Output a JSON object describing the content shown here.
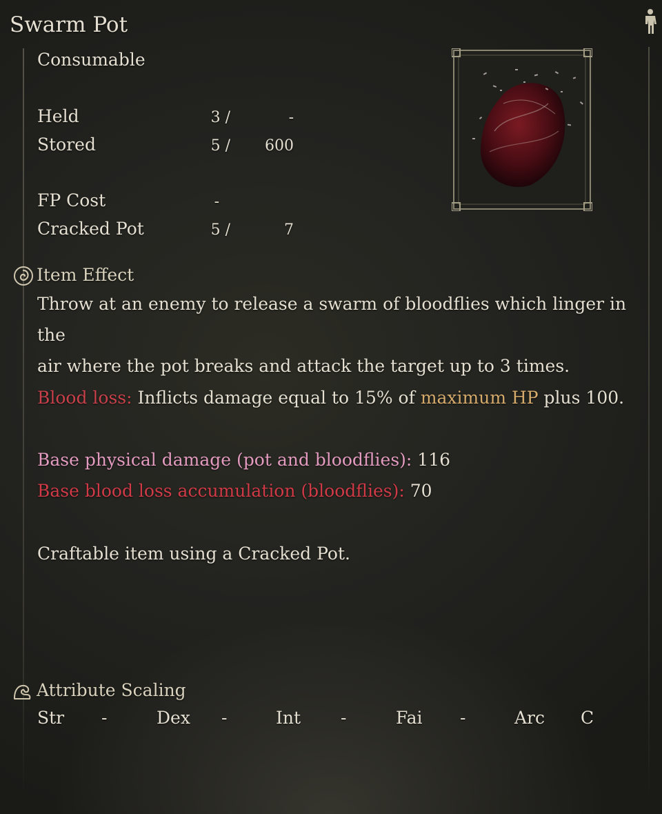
{
  "item": {
    "title": "Swarm Pot",
    "category": "Consumable"
  },
  "stats": {
    "held": {
      "label": "Held",
      "current": "3 /",
      "max": "-"
    },
    "stored": {
      "label": "Stored",
      "current": "5 /",
      "max": "600"
    },
    "fp_cost": {
      "label": "FP Cost",
      "value": "-"
    },
    "cracked_pot": {
      "label": "Cracked Pot",
      "current": "5 /",
      "max": "7"
    }
  },
  "item_effect": {
    "heading": "Item Effect",
    "desc_line1": "Throw at an enemy to release a swarm of bloodflies which linger in the",
    "desc_line2": "air where the pot breaks and attack the target up to 3 times.",
    "blood_loss_label": "Blood loss:",
    "blood_loss_text1": " Inflicts damage equal to 15% of ",
    "blood_loss_highlight": "maximum HP",
    "blood_loss_text2": " plus 100.",
    "phys_label": "Base physical damage (pot and bloodflies):",
    "phys_value": " 116",
    "bloodacc_label": "Base blood loss accumulation (bloodflies):",
    "bloodacc_value": " 70",
    "craft_note": "Craftable item using a Cracked Pot."
  },
  "attribute_scaling": {
    "heading": "Attribute Scaling",
    "items": [
      {
        "label": "Str",
        "value": "-"
      },
      {
        "label": "Dex",
        "value": "-"
      },
      {
        "label": "Int",
        "value": "-"
      },
      {
        "label": "Fai",
        "value": "-"
      },
      {
        "label": "Arc",
        "value": "C"
      }
    ]
  },
  "icons": {
    "equipment_figure": "figure-icon",
    "item_effect": "swirl-icon",
    "attribute_scaling": "arm-icon"
  },
  "colors": {
    "blood_loss": "#c8404a",
    "highlight": "#d6ab6c",
    "physical": "#e39bbf",
    "blood_accum": "#cf3a46"
  }
}
